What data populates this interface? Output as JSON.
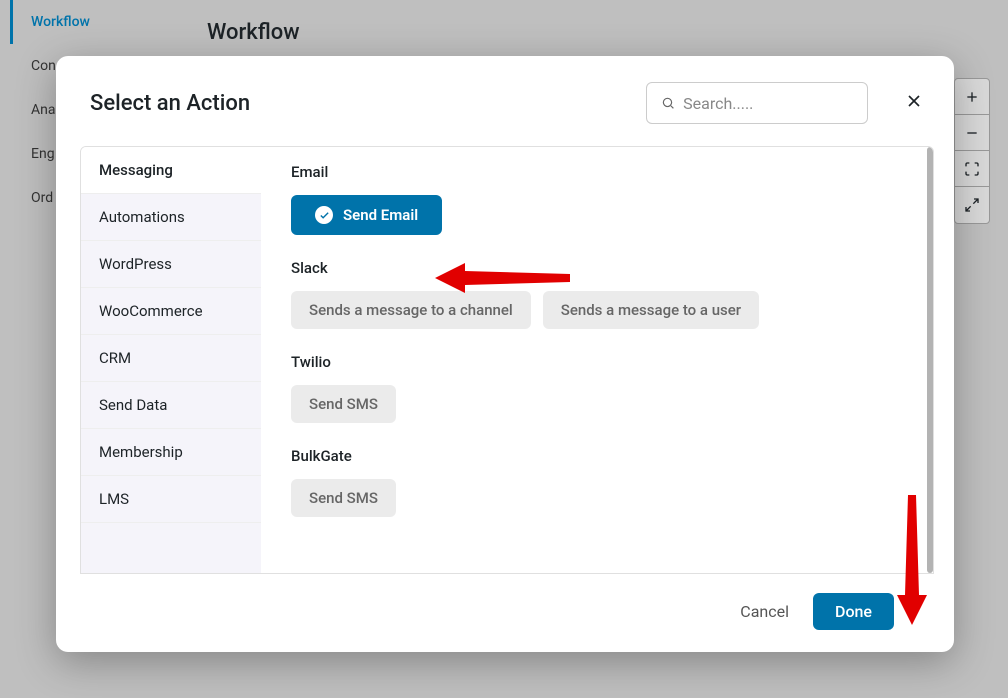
{
  "bg": {
    "title": "Workflow",
    "sidebar": [
      "Workflow",
      "Con",
      "Ana",
      "Eng",
      "Ord"
    ]
  },
  "modal": {
    "title": "Select an Action",
    "search_placeholder": "Search.....",
    "categories": [
      "Messaging",
      "Automations",
      "WordPress",
      "WooCommerce",
      "CRM",
      "Send Data",
      "Membership",
      "LMS"
    ],
    "groups": [
      {
        "title": "Email",
        "actions": [
          {
            "label": "Send Email",
            "selected": true
          }
        ]
      },
      {
        "title": "Slack",
        "actions": [
          {
            "label": "Sends a message to a channel",
            "selected": false
          },
          {
            "label": "Sends a message to a user",
            "selected": false
          }
        ]
      },
      {
        "title": "Twilio",
        "actions": [
          {
            "label": "Send SMS",
            "selected": false
          }
        ]
      },
      {
        "title": "BulkGate",
        "actions": [
          {
            "label": "Send SMS",
            "selected": false
          }
        ]
      }
    ],
    "cancel": "Cancel",
    "done": "Done"
  }
}
